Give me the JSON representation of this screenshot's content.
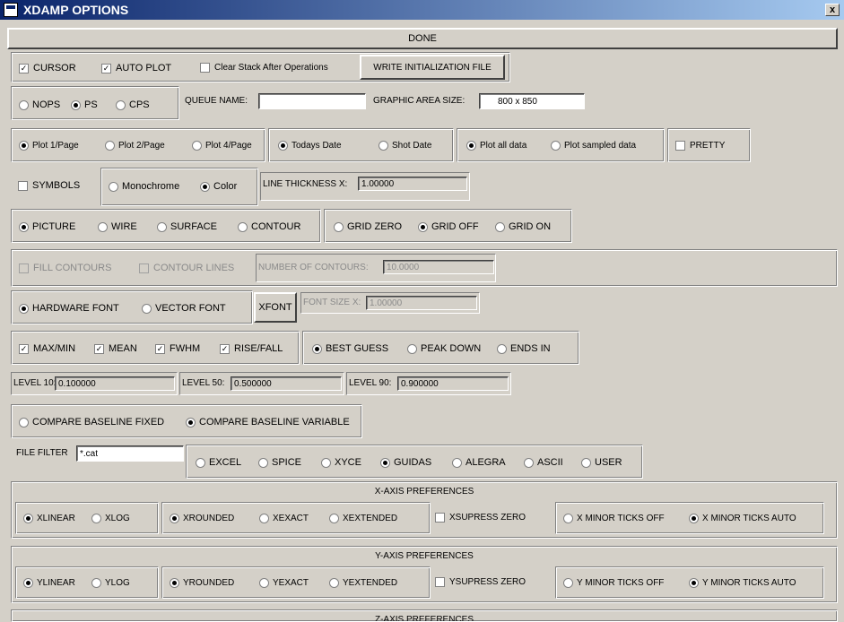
{
  "window": {
    "title": "XDAMP OPTIONS",
    "close": "x"
  },
  "done": "DONE",
  "row1": {
    "cursor": "CURSOR",
    "autoplot": "AUTO PLOT",
    "clear_stack": "Clear Stack After Operations",
    "write_init": "WRITE INITIALIZATION FILE"
  },
  "row2": {
    "nops": "NOPS",
    "ps": "PS",
    "cps": "CPS",
    "queue_label": "QUEUE NAME:",
    "queue_value": "",
    "graphic_label": "GRAPHIC AREA SIZE:",
    "graphic_value": "800 x 850"
  },
  "row3": {
    "p1": "Plot 1/Page",
    "p2": "Plot 2/Page",
    "p4": "Plot 4/Page",
    "today": "Todays Date",
    "shot": "Shot Date",
    "all": "Plot all data",
    "sampled": "Plot sampled data",
    "pretty": "PRETTY"
  },
  "row4": {
    "symbols": "SYMBOLS",
    "mono": "Monochrome",
    "color": "Color",
    "lt_label": "LINE THICKNESS X:",
    "lt_value": "1.00000"
  },
  "row5": {
    "picture": "PICTURE",
    "wire": "WIRE",
    "surface": "SURFACE",
    "contour": "CONTOUR",
    "gz": "GRID ZERO",
    "goff": "GRID OFF",
    "gon": "GRID ON"
  },
  "row6": {
    "fill": "FILL CONTOURS",
    "lines": "CONTOUR LINES",
    "num_label": "NUMBER OF CONTOURS:",
    "num_value": "10.0000"
  },
  "row7": {
    "hw": "HARDWARE FONT",
    "vf": "VECTOR FONT",
    "xfont": "XFONT",
    "fs_label": "FONT SIZE X:",
    "fs_value": "1.00000"
  },
  "row8": {
    "maxmin": "MAX/MIN",
    "mean": "MEAN",
    "fwhm": "FWHM",
    "rise": "RISE/FALL",
    "best": "BEST GUESS",
    "peak": "PEAK DOWN",
    "ends": "ENDS IN"
  },
  "row9": {
    "l10_label": "LEVEL 10:",
    "l10": "0.100000",
    "l50_label": "LEVEL 50:",
    "l50": "0.500000",
    "l90_label": "LEVEL 90:",
    "l90": "0.900000"
  },
  "row10": {
    "fixed": "COMPARE BASELINE FIXED",
    "variable": "COMPARE BASELINE VARIABLE"
  },
  "row11": {
    "ff_label": "FILE FILTER",
    "ff_value": "*.cat",
    "excel": "EXCEL",
    "spice": "SPICE",
    "xyce": "XYCE",
    "guidas": "GUIDAS",
    "alegra": "ALEGRA",
    "ascii": "ASCII",
    "user": "USER"
  },
  "xaxis": {
    "title": "X-AXIS PREFERENCES",
    "linear": "XLINEAR",
    "log": "XLOG",
    "rounded": "XROUNDED",
    "exact": "XEXACT",
    "extended": "XEXTENDED",
    "supress": "XSUPRESS ZERO",
    "ticks_off": "X MINOR TICKS OFF",
    "ticks_auto": "X MINOR TICKS AUTO"
  },
  "yaxis": {
    "title": "Y-AXIS PREFERENCES",
    "linear": "YLINEAR",
    "log": "YLOG",
    "rounded": "YROUNDED",
    "exact": "YEXACT",
    "extended": "YEXTENDED",
    "supress": "YSUPRESS ZERO",
    "ticks_off": "Y MINOR TICKS OFF",
    "ticks_auto": "Y MINOR TICKS AUTO"
  },
  "zaxis": {
    "title": "Z-AXIS PREFERENCES"
  }
}
